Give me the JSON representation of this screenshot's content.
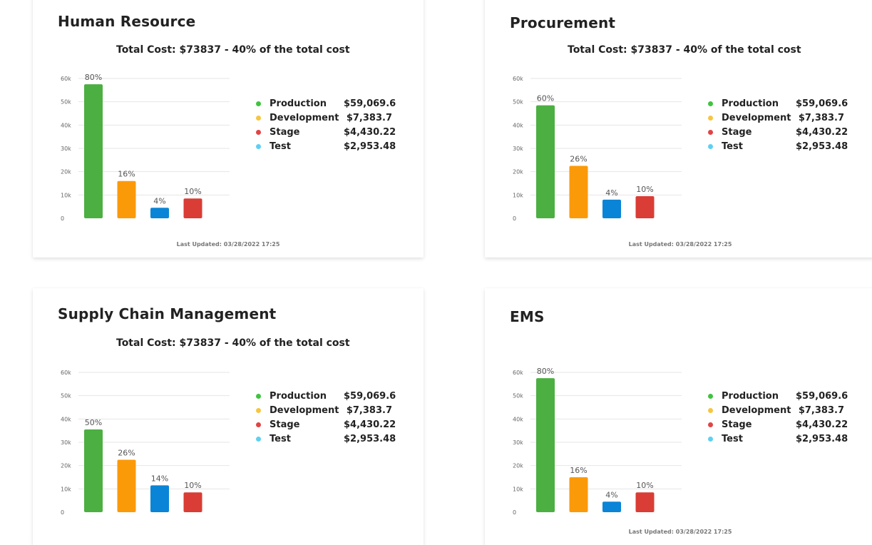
{
  "common": {
    "total_line": "Total Cost: $73837  -  40% of the total cost",
    "last_updated": "Last Updated: 03/28/2022 17:25",
    "legend": [
      {
        "name": "Production",
        "value": "$59,069.6",
        "color": "#3ec43e"
      },
      {
        "name": "Development",
        "value": "$7,383.7",
        "color": "#f6c542"
      },
      {
        "name": "Stage",
        "value": "$4,430.22",
        "color": "#e24444"
      },
      {
        "name": "Test",
        "value": "$2,953.48",
        "color": "#5ed0f2"
      }
    ]
  },
  "cards": [
    {
      "title": "Human Resource",
      "total_line": "Total Cost: $73837  -  40% of the total cost",
      "last_updated": "Last Updated: 03/28/2022 17:25"
    },
    {
      "title": "Procurement",
      "total_line": "Total Cost: $73837  -  40% of the total cost",
      "last_updated": "Last Updated: 03/28/2022 17:25"
    },
    {
      "title": "Supply Chain Management",
      "total_line": "Total Cost: $73837  -  40% of the total cost",
      "last_updated": ""
    },
    {
      "title": "EMS",
      "total_line": "",
      "last_updated": "Last Updated: 03/28/2022 17:25"
    }
  ],
  "chart_data": [
    {
      "type": "bar",
      "categories": [
        "Production",
        "Development",
        "Stage",
        "Test"
      ],
      "values": [
        57500,
        16000,
        4500,
        8500
      ],
      "labels": [
        "80%",
        "16%",
        "4%",
        "10%"
      ],
      "ylim": [
        0,
        60000
      ],
      "yticks": [
        "0",
        "10k",
        "20k",
        "30k",
        "40k",
        "50k",
        "60k"
      ],
      "colors": [
        "#4caf42",
        "#fb9a09",
        "#0a84d6",
        "#d93d35"
      ]
    },
    {
      "type": "bar",
      "categories": [
        "Production",
        "Development",
        "Stage",
        "Test"
      ],
      "values": [
        48500,
        22500,
        8000,
        9500
      ],
      "labels": [
        "60%",
        "26%",
        "4%",
        "10%"
      ],
      "ylim": [
        0,
        60000
      ],
      "yticks": [
        "0",
        "10k",
        "20k",
        "30k",
        "40k",
        "50k",
        "60k"
      ],
      "colors": [
        "#4caf42",
        "#fb9a09",
        "#0a84d6",
        "#d93d35"
      ]
    },
    {
      "type": "bar",
      "categories": [
        "Production",
        "Development",
        "Stage",
        "Test"
      ],
      "values": [
        35500,
        22500,
        11500,
        8500
      ],
      "labels": [
        "50%",
        "26%",
        "14%",
        "10%"
      ],
      "ylim": [
        0,
        60000
      ],
      "yticks": [
        "0",
        "10k",
        "20k",
        "30k",
        "40k",
        "50k",
        "60k"
      ],
      "colors": [
        "#4caf42",
        "#fb9a09",
        "#0a84d6",
        "#d93d35"
      ]
    },
    {
      "type": "bar",
      "categories": [
        "Production",
        "Development",
        "Stage",
        "Test"
      ],
      "values": [
        57500,
        15000,
        4500,
        8500
      ],
      "labels": [
        "80%",
        "16%",
        "4%",
        "10%"
      ],
      "ylim": [
        0,
        60000
      ],
      "yticks": [
        "0",
        "10k",
        "20k",
        "30k",
        "40k",
        "50k",
        "60k"
      ],
      "colors": [
        "#4caf42",
        "#fb9a09",
        "#0a84d6",
        "#d93d35"
      ]
    }
  ]
}
